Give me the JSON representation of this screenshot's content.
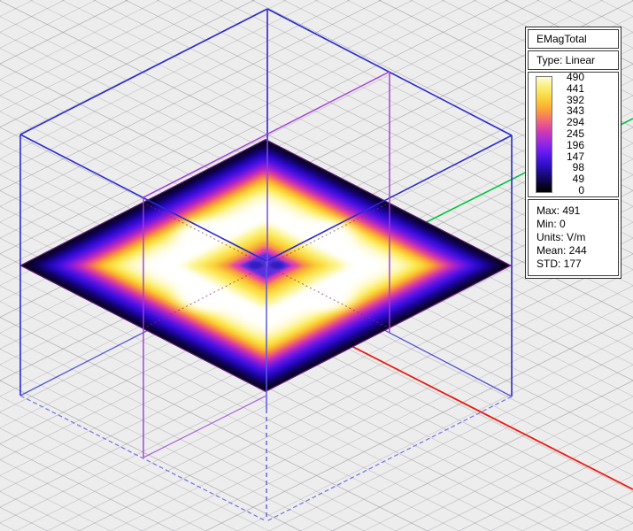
{
  "legend": {
    "title": "EMagTotal",
    "type_label": "Type: Linear",
    "colorbar_ticks": [
      "490",
      "441",
      "392",
      "343",
      "294",
      "245",
      "196",
      "147",
      "98",
      "49",
      "0"
    ],
    "stats": [
      "Max: 491",
      "Min: 0",
      "Units: V/m",
      "Mean: 244",
      "STD: 177"
    ]
  },
  "field": {
    "quantity": "EMagTotal",
    "scale_type": "Linear",
    "max": 491,
    "min": 0,
    "units": "V/m",
    "mean": 244,
    "std": 177
  },
  "colors": {
    "axis_x_red": "#ea1b12",
    "axis_y_green": "#00c23c",
    "axis_z_blue": "#4336d8",
    "wireframe_blue": "#2b2bd0",
    "wireframe_purple": "#a13ad8",
    "plane_border_purple": "#6d1a8e",
    "background": "#ededed",
    "colorbar_top": "#fdfcd8",
    "colorbar_bottom": "#000000"
  },
  "chart_data": {
    "type": "heatmap",
    "title": "EMagTotal",
    "scale": "Linear",
    "colorbar_values": [
      490,
      441,
      392,
      343,
      294,
      245,
      196,
      147,
      98,
      49,
      0
    ],
    "stats": {
      "max": 491,
      "min": 0,
      "units": "V/m",
      "mean": 244,
      "std": 177
    },
    "description": "Electric field magnitude on the horizontal mid-plane cut of a wireframe box: 0 V/m (black) at plate edges, four ~490 V/m (white) lobes around the center, local dip of ~150 V/m (indigo) at the exact center"
  }
}
